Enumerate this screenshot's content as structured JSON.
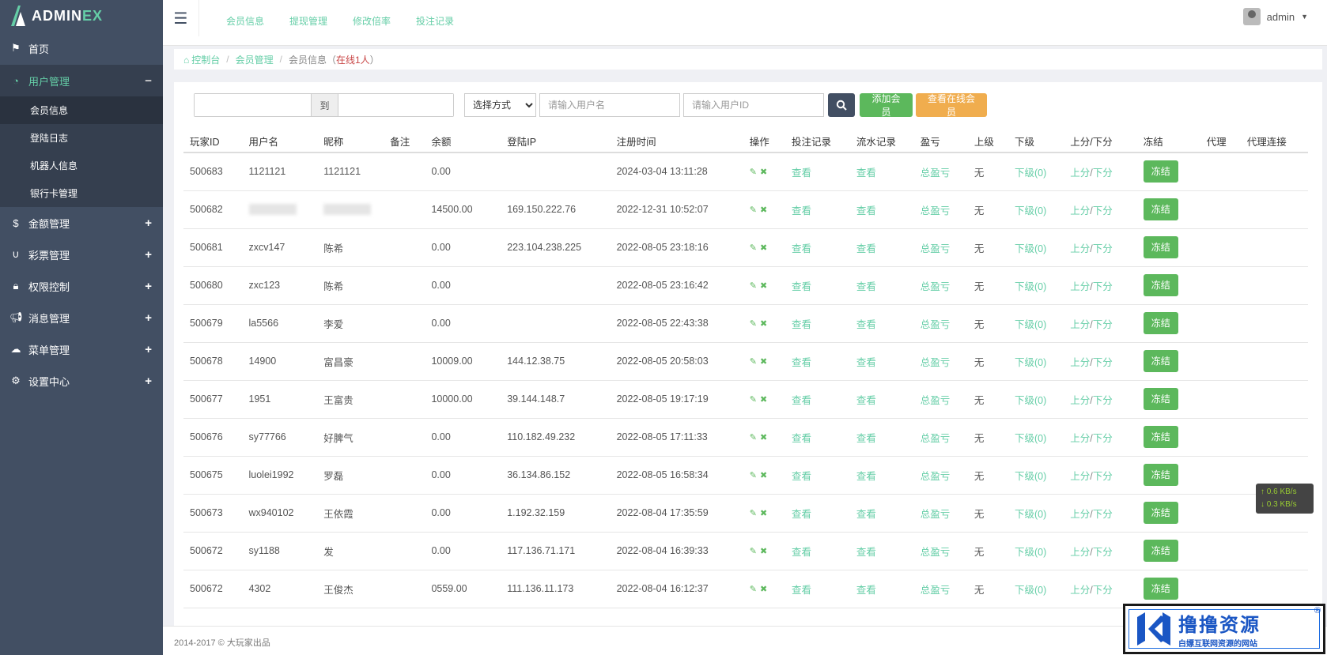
{
  "sidebar": {
    "logo_text_main": "ADMIN",
    "logo_text_accent": "EX",
    "items": [
      {
        "label": "首页",
        "icon": "flag-icon"
      },
      {
        "label": "用户管理",
        "icon": "dashboard-icon",
        "toggle": "−",
        "open": true,
        "sub": [
          "会员信息",
          "登陆日志",
          "机器人信息",
          "银行卡管理"
        ]
      },
      {
        "label": "金额管理",
        "icon": "dollar-icon",
        "toggle": "+"
      },
      {
        "label": "彩票管理",
        "icon": "magnet-icon",
        "toggle": "+"
      },
      {
        "label": "权限控制",
        "icon": "lock-icon",
        "toggle": "+"
      },
      {
        "label": "消息管理",
        "icon": "bullhorn-icon",
        "toggle": "+"
      },
      {
        "label": "菜单管理",
        "icon": "cloud-icon",
        "toggle": "+"
      },
      {
        "label": "设置中心",
        "icon": "gear-icon",
        "toggle": "+"
      }
    ]
  },
  "header": {
    "links": [
      "会员信息",
      "提现管理",
      "修改倍率",
      "投注记录"
    ],
    "user": "admin"
  },
  "breadcrumb": {
    "home": "控制台",
    "section": "会员管理",
    "current": "会员信息（",
    "online": "在线1人",
    "close": "）"
  },
  "toolbar": {
    "to_label": "到",
    "select_value": "选择方式",
    "username_placeholder": "请输入用户名",
    "userid_placeholder": "请输入用户ID",
    "add_member": "添加会员",
    "view_online": "查看在线会员"
  },
  "table": {
    "headers": [
      "玩家ID",
      "用户名",
      "昵称",
      "备注",
      "余额",
      "登陆IP",
      "注册时间",
      "操作",
      "投注记录",
      "流水记录",
      "盈亏",
      "上级",
      "下级",
      "上分/下分",
      "冻结",
      "代理",
      "代理连接"
    ],
    "link_texts": {
      "bet": "查看",
      "flow": "查看",
      "profit": "总盈亏",
      "parent": "无",
      "children": "下级(0)",
      "up": "上分",
      "slash": "/",
      "down": "下分",
      "freeze": "冻结"
    },
    "rows": [
      {
        "id": "500683",
        "username": "1121121",
        "nick": "1121121",
        "note": "",
        "balance": "0.00",
        "ip": "",
        "reg": "2024-03-04 13:11:28"
      },
      {
        "id": "500682",
        "username": "",
        "nick": "",
        "note": "",
        "balance": "14500.00",
        "ip": "169.150.222.76",
        "reg": "2022-12-31 10:52:07",
        "blurred": true
      },
      {
        "id": "500681",
        "username": "zxcv147",
        "nick": "陈希",
        "note": "",
        "balance": "0.00",
        "ip": "223.104.238.225",
        "reg": "2022-08-05 23:18:16"
      },
      {
        "id": "500680",
        "username": "zxc123",
        "nick": "陈希",
        "note": "",
        "balance": "0.00",
        "ip": "",
        "reg": "2022-08-05 23:16:42"
      },
      {
        "id": "500679",
        "username": "la5566",
        "nick": "李爱",
        "note": "",
        "balance": "0.00",
        "ip": "",
        "reg": "2022-08-05 22:43:38"
      },
      {
        "id": "500678",
        "username": "14900",
        "nick": "富昌豪",
        "note": "",
        "balance": "10009.00",
        "ip": "144.12.38.75",
        "reg": "2022-08-05 20:58:03"
      },
      {
        "id": "500677",
        "username": "1951",
        "nick": "王富贵",
        "note": "",
        "balance": "10000.00",
        "ip": "39.144.148.7",
        "reg": "2022-08-05 19:17:19"
      },
      {
        "id": "500676",
        "username": "sy77766",
        "nick": "好脾气",
        "note": "",
        "balance": "0.00",
        "ip": "110.182.49.232",
        "reg": "2022-08-05 17:11:33"
      },
      {
        "id": "500675",
        "username": "luolei1992",
        "nick": "罗磊",
        "note": "",
        "balance": "0.00",
        "ip": "36.134.86.152",
        "reg": "2022-08-05 16:58:34"
      },
      {
        "id": "500673",
        "username": "wx940102",
        "nick": "王依霞",
        "note": "",
        "balance": "0.00",
        "ip": "1.192.32.159",
        "reg": "2022-08-04 17:35:59"
      },
      {
        "id": "500672",
        "username": "sy1188",
        "nick": "发",
        "note": "",
        "balance": "0.00",
        "ip": "117.136.71.171",
        "reg": "2022-08-04 16:39:33"
      },
      {
        "id": "500672",
        "username": "4302",
        "nick": "王俊杰",
        "note": "",
        "balance": "0559.00",
        "ip": "111.136.11.173",
        "reg": "2022-08-04 16:12:37"
      }
    ]
  },
  "footer": "2014-2017 © 大玩家出品",
  "netspeed": {
    "up": "↑ 0.6 KB/s",
    "down": "↓ 0.3 KB/s"
  },
  "watermark": {
    "title": "撸撸资源",
    "subtitle": "白嫖互联网资源的网站",
    "reg": "®"
  }
}
